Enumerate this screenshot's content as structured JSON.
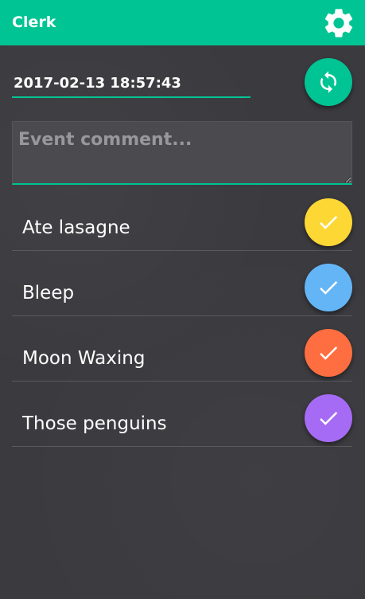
{
  "app": {
    "title": "Clerk",
    "accent_color": "#00c493",
    "background_color": "#3b3b3f"
  },
  "header": {
    "settings_icon": "gear-icon"
  },
  "timestamp": {
    "value": "2017-02-13 18:57:43",
    "refresh_icon": "refresh-icon"
  },
  "comment": {
    "placeholder": "Event comment...",
    "value": ""
  },
  "events": [
    {
      "label": "Ate lasagne",
      "color": "#fdd835",
      "icon": "check-icon"
    },
    {
      "label": "Bleep",
      "color": "#64b5f6",
      "icon": "check-icon"
    },
    {
      "label": "Moon Waxing",
      "color": "#ff6e40",
      "icon": "check-icon"
    },
    {
      "label": "Those penguins",
      "color": "#a66bf5",
      "icon": "check-icon"
    }
  ]
}
